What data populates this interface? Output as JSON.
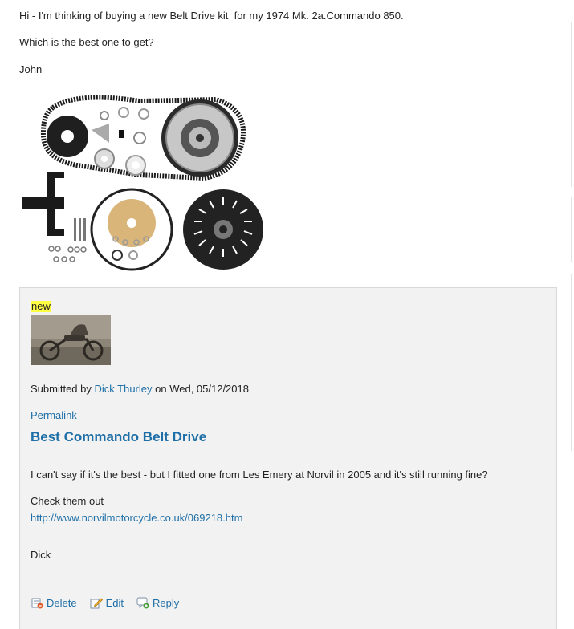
{
  "post": {
    "line1": "Hi - I'm thinking of buying a new Belt Drive kit  for my 1974 Mk. 2a.Commando 850.",
    "line2": "Which is the best one to get?",
    "signature": "John"
  },
  "comment": {
    "badge": "new",
    "submitted_prefix": "Submitted by ",
    "author": "Dick Thurley",
    "submitted_suffix": " on Wed, 05/12/2018",
    "permalink": "Permalink",
    "title": "Best Commando Belt Drive",
    "body1": "I can't say if it's the best - but I fitted one from Les Emery at Norvil in 2005 and it's still running fine?",
    "body2": "Check them out",
    "url": "http://www.norvilmotorcycle.co.uk/069218.htm",
    "signoff": "Dick",
    "actions": {
      "delete": "Delete",
      "edit": "Edit",
      "reply": "Reply"
    }
  },
  "icons": [
    "delete-icon",
    "edit-icon",
    "reply-icon"
  ],
  "colors": {
    "link": "#1e6fa7",
    "badge_bg": "#ffff44",
    "comment_bg": "#f2f2f2"
  }
}
